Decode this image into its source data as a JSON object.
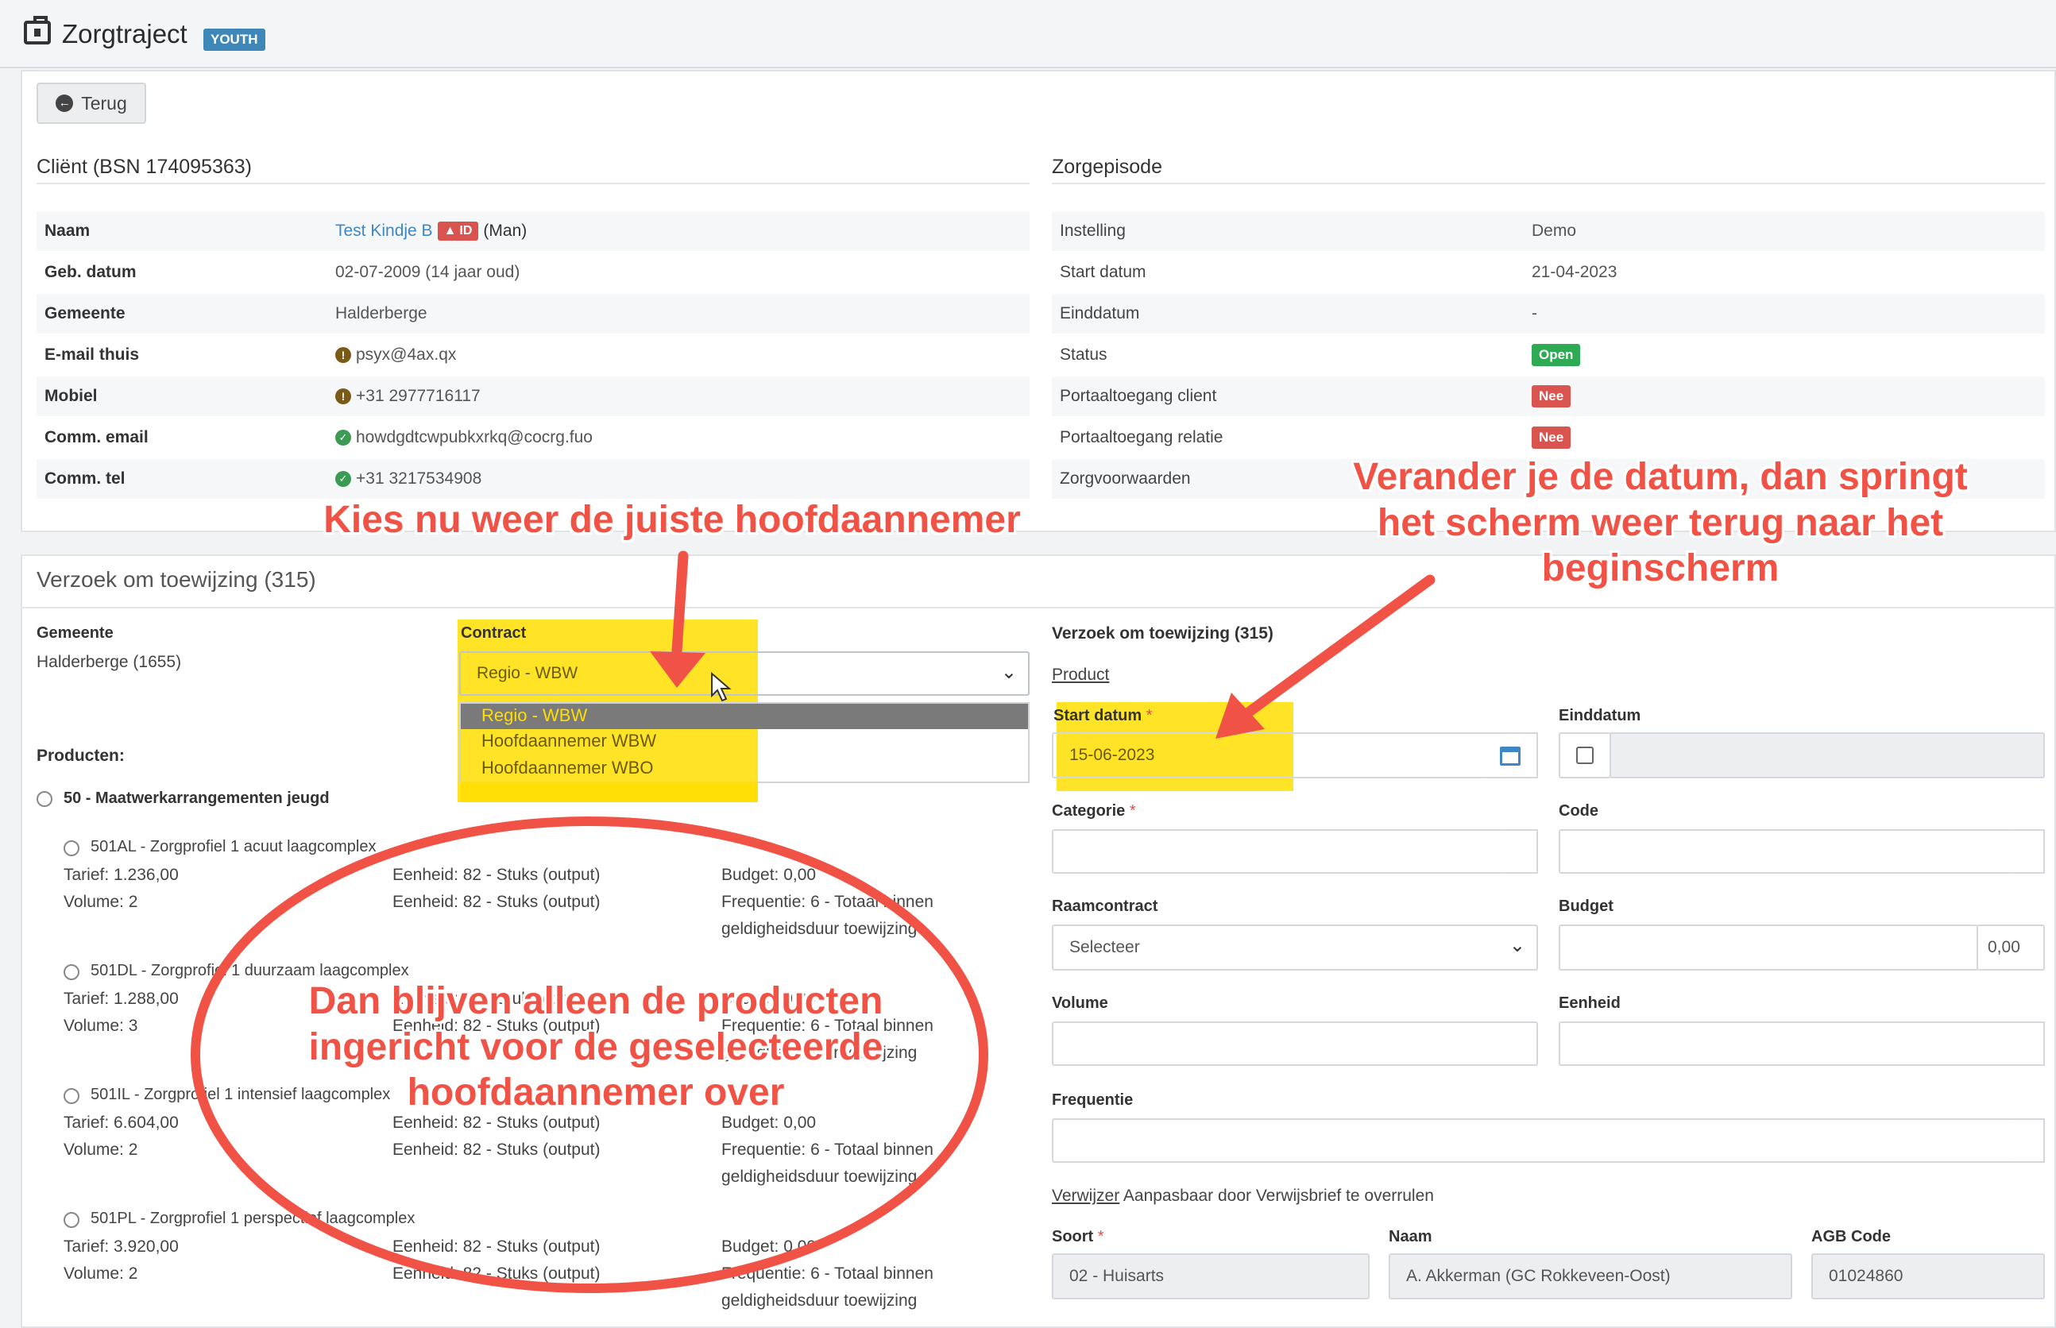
{
  "header": {
    "title": "Zorgtraject",
    "badge": "YOUTH"
  },
  "toolbar": {
    "back_label": "Terug"
  },
  "client": {
    "title": "Cliënt (BSN 174095363)",
    "rows": [
      {
        "label": "Naam",
        "value": "Test Kindje B",
        "id_tag": "ID",
        "suffix": "(Man)"
      },
      {
        "label": "Geb. datum",
        "value": "02-07-2009 (14 jaar oud)"
      },
      {
        "label": "Gemeente",
        "value": "Halderberge"
      },
      {
        "label": "E-mail thuis",
        "value": "psyx@4ax.qx",
        "icon": "warning-icon"
      },
      {
        "label": "Mobiel",
        "value": "+31 2977716117",
        "icon": "warning-icon"
      },
      {
        "label": "Comm. email",
        "value": "howdgdtcwpubkxrkq@cocrg.fuo",
        "icon": "check-icon"
      },
      {
        "label": "Comm. tel",
        "value": "+31 3217534908",
        "icon": "check-icon"
      }
    ]
  },
  "episode": {
    "title": "Zorgepisode",
    "rows": [
      {
        "label": "Instelling",
        "value": "Demo"
      },
      {
        "label": "Start datum",
        "value": "21-04-2023"
      },
      {
        "label": "Einddatum",
        "value": "-"
      },
      {
        "label": "Status",
        "value": "Open",
        "color": "#2eaa55"
      },
      {
        "label": "Portaaltoegang client",
        "value": "Nee",
        "color": "#d9534f"
      },
      {
        "label": "Portaaltoegang relatie",
        "value": "Nee",
        "color": "#d9534f"
      },
      {
        "label": "Zorgvoorwaarden",
        "value": ""
      }
    ]
  },
  "request": {
    "title": "Verzoek om toewijzing (315)",
    "gemeente_label": "Gemeente",
    "gemeente_value": "Halderberge (1655)",
    "contract_label": "Contract",
    "contract_value": "Regio - WBW",
    "contract_options": [
      "Regio - WBW",
      "Hoofdaannemer WBW",
      "Hoofdaannemer WBO"
    ],
    "producten_label": "Producten:",
    "group": "50 - Maatwerkarrangementen jeugd",
    "products": [
      {
        "code": "501AL",
        "name": " - Zorgprofiel 1 acuut laagcomplex",
        "tarief": "Tarief: 1.236,00",
        "volume": "Volume: 2",
        "eenheid1": "Eenheid: 82 - Stuks (output)",
        "eenheid2": "Eenheid: 82 - Stuks (output)",
        "budget": "Budget: 0,00",
        "freq": "Frequentie: 6 - Totaal binnen",
        "freq2": "geldigheidsduur toewijzing"
      },
      {
        "code": "501DL",
        "name": " - Zorgprofiel 1 duurzaam laagcomplex",
        "tarief": "Tarief: 1.288,00",
        "volume": "Volume: 3",
        "eenheid1": "Eenheid: 82 - Stuks (output)",
        "eenheid2": "Eenheid: 82 - Stuks (output)",
        "budget": "Budget: 0,00",
        "freq": "Frequentie: 6 - Totaal binnen",
        "freq2": "geldigheidsduur toewijzing"
      },
      {
        "code": "501IL",
        "name": " - Zorgprofiel 1 intensief laagcomplex",
        "tarief": "Tarief: 6.604,00",
        "volume": "Volume: 2",
        "eenheid1": "Eenheid: 82 - Stuks (output)",
        "eenheid2": "Eenheid: 82 - Stuks (output)",
        "budget": "Budget: 0,00",
        "freq": "Frequentie: 6 - Totaal binnen",
        "freq2": "geldigheidsduur toewijzing"
      },
      {
        "code": "501PL",
        "name": " - Zorgprofiel 1 perspectief laagcomplex",
        "tarief": "Tarief: 3.920,00",
        "volume": "Volume: 2",
        "eenheid1": "Eenheid: 82 - Stuks (output)",
        "eenheid2": "Eenheid: 82 - Stuks (output)",
        "budget": "Budget: 0,00",
        "freq": "Frequentie: 6 - Totaal binnen",
        "freq2": "geldigheidsduur toewijzing"
      }
    ]
  },
  "form": {
    "title": "Verzoek om toewijzing (315)",
    "product_link": "Product",
    "start_label": "Start datum",
    "start_value": "15-06-2023",
    "end_label": "Einddatum",
    "categorie_label": "Categorie",
    "code_label": "Code",
    "raamcontract_label": "Raamcontract",
    "raamcontract_value": "Selecteer",
    "budget_label": "Budget",
    "budget_value": "0,00",
    "volume_label": "Volume",
    "eenheid_label": "Eenheid",
    "frequentie_label": "Frequentie",
    "verwijzer_link": "Verwijzer",
    "verwijzer_note": " Aanpasbaar door Verwijsbrief te overrulen",
    "soort_label": "Soort",
    "soort_value": "02 - Huisarts",
    "naam_label": "Naam",
    "naam_value": "A. Akkerman (GC Rokkeveen-Oost)",
    "agb_label": "AGB Code",
    "agb_value": "01024860",
    "required_mark": "*"
  },
  "annotations": {
    "a1": "Kies nu weer de juiste hoofdaannemer",
    "a2_l1": "Verander je de datum, dan springt",
    "a2_l2": "het scherm weer terug naar het",
    "a2_l3": "beginscherm",
    "a3_l1": "Dan blijven alleen de producten",
    "a3_l2": "ingericht voor de geselecteerde",
    "a3_l3": "hoofdaannemer over",
    "color": "#f05346",
    "highlight": "#ffde00"
  }
}
